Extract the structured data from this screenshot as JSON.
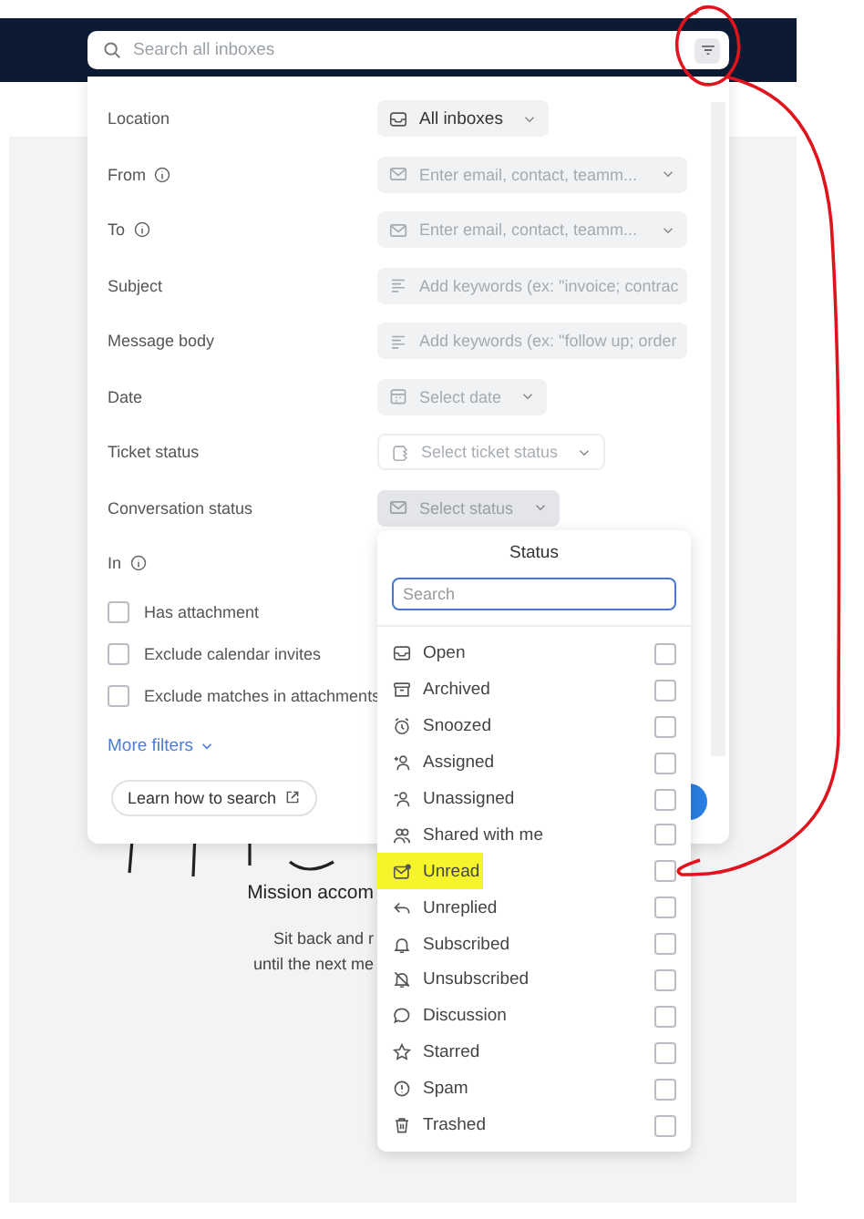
{
  "search": {
    "placeholder": "Search all inboxes"
  },
  "filters": [
    {
      "label": "Location",
      "kind": "select",
      "value": "All inboxes"
    },
    {
      "label": "From",
      "info": true,
      "kind": "field",
      "placeholder": "Enter email, contact, teamm..."
    },
    {
      "label": "To",
      "info": true,
      "kind": "field",
      "placeholder": "Enter email, contact, teamm..."
    },
    {
      "label": "Subject",
      "kind": "text",
      "placeholder": "Add keywords (ex: \"invoice; contrac"
    },
    {
      "label": "Message body",
      "kind": "text",
      "placeholder": "Add keywords (ex: \"follow up; order"
    },
    {
      "label": "Date",
      "kind": "select",
      "placeholder": "Select date"
    },
    {
      "label": "Ticket status",
      "kind": "select",
      "placeholder": "Select ticket status",
      "disabled": true
    },
    {
      "label": "Conversation status",
      "kind": "select",
      "placeholder": "Select status",
      "expanded": true
    },
    {
      "label": "In",
      "info": true,
      "kind": "label"
    }
  ],
  "checkboxes": [
    {
      "label": "Has attachment",
      "checked": false
    },
    {
      "label": "Exclude calendar invites",
      "checked": false
    },
    {
      "label": "Exclude matches in attachments",
      "checked": false
    }
  ],
  "more_filters": "More filters",
  "learn_button": "Learn how to search",
  "empty_state": {
    "title": "Mission accom",
    "lines": [
      "Sit back and r",
      "until the next me"
    ]
  },
  "status_menu": {
    "title": "Status",
    "search_placeholder": "Search",
    "items": [
      {
        "label": "Open",
        "checked": false
      },
      {
        "label": "Archived",
        "checked": false
      },
      {
        "label": "Snoozed",
        "checked": false
      },
      {
        "label": "Assigned",
        "checked": false
      },
      {
        "label": "Unassigned",
        "checked": false
      },
      {
        "label": "Shared with me",
        "checked": false
      },
      {
        "label": "Unread",
        "checked": false,
        "highlighted": true
      },
      {
        "label": "Unreplied",
        "checked": false
      },
      {
        "label": "Subscribed",
        "checked": false
      },
      {
        "label": "Unsubscribed",
        "checked": false
      },
      {
        "label": "Discussion",
        "checked": false
      },
      {
        "label": "Starred",
        "checked": false
      },
      {
        "label": "Spam",
        "checked": false
      },
      {
        "label": "Trashed",
        "checked": false
      }
    ]
  },
  "freehand_annotation": true
}
